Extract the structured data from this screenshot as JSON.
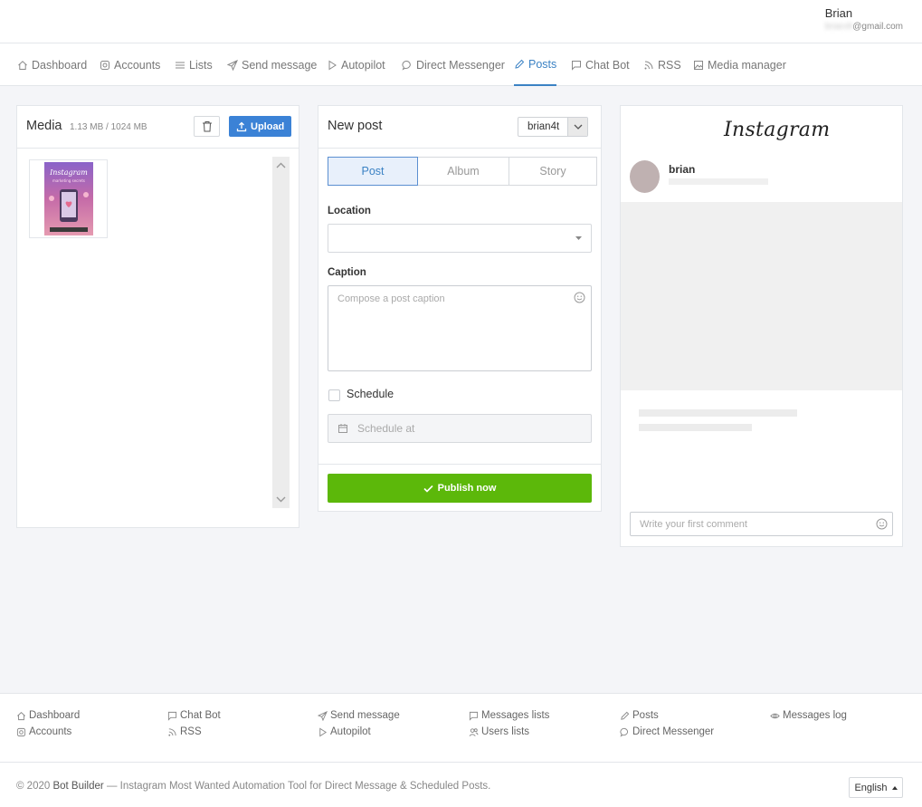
{
  "user": {
    "name": "Brian",
    "email_masked": "brian4t",
    "email_domain": "@gmail.com"
  },
  "nav": {
    "items": [
      {
        "label": "Dashboard",
        "icon": "home-icon"
      },
      {
        "label": "Accounts",
        "icon": "instagram-icon"
      },
      {
        "label": "Lists",
        "icon": "list-icon"
      },
      {
        "label": "Send message",
        "icon": "send-icon"
      },
      {
        "label": "Autopilot",
        "icon": "play-icon"
      },
      {
        "label": "Direct Messenger",
        "icon": "chat-bubble-icon"
      },
      {
        "label": "Posts",
        "icon": "pencil-icon",
        "active": true
      },
      {
        "label": "Chat Bot",
        "icon": "message-square-icon"
      },
      {
        "label": "RSS",
        "icon": "rss-icon"
      },
      {
        "label": "Media manager",
        "icon": "image-icon"
      }
    ]
  },
  "media": {
    "title": "Media",
    "size": "1.13 MB / 1024 MB",
    "upload_label": "Upload",
    "thumb_title": "Instagram",
    "thumb_subtitle": "marketing secrets"
  },
  "new_post": {
    "title": "New post",
    "account": "brian4t",
    "tabs": [
      "Post",
      "Album",
      "Story"
    ],
    "active_tab": "Post",
    "location_label": "Location",
    "caption_label": "Caption",
    "caption_placeholder": "Compose a post caption",
    "schedule_label": "Schedule",
    "schedule_placeholder": "Schedule at",
    "publish_label": "Publish now"
  },
  "preview": {
    "logo": "Instagram",
    "username": "brian",
    "comment_placeholder": "Write your first comment"
  },
  "footer": {
    "links": [
      {
        "label": "Dashboard",
        "icon": "home-icon"
      },
      {
        "label": "Accounts",
        "icon": "instagram-icon"
      },
      {
        "label": "Chat Bot",
        "icon": "message-square-icon"
      },
      {
        "label": "RSS",
        "icon": "rss-icon"
      },
      {
        "label": "Send message",
        "icon": "send-icon"
      },
      {
        "label": "Autopilot",
        "icon": "play-icon"
      },
      {
        "label": "Messages lists",
        "icon": "message-square-icon"
      },
      {
        "label": "Users lists",
        "icon": "users-icon"
      },
      {
        "label": "Posts",
        "icon": "pencil-icon"
      },
      {
        "label": "Direct Messenger",
        "icon": "chat-bubble-icon"
      },
      {
        "label": "Messages log",
        "icon": "eye-icon"
      }
    ],
    "copyright_prefix": "© 2020",
    "brand": "Bot Builder",
    "copyright_suffix": "— Instagram Most Wanted Automation Tool for Direct Message & Scheduled Posts.",
    "language": "English"
  },
  "colors": {
    "accent": "#3b82c4",
    "upload": "#3b82d6",
    "publish": "#5cb80a"
  }
}
